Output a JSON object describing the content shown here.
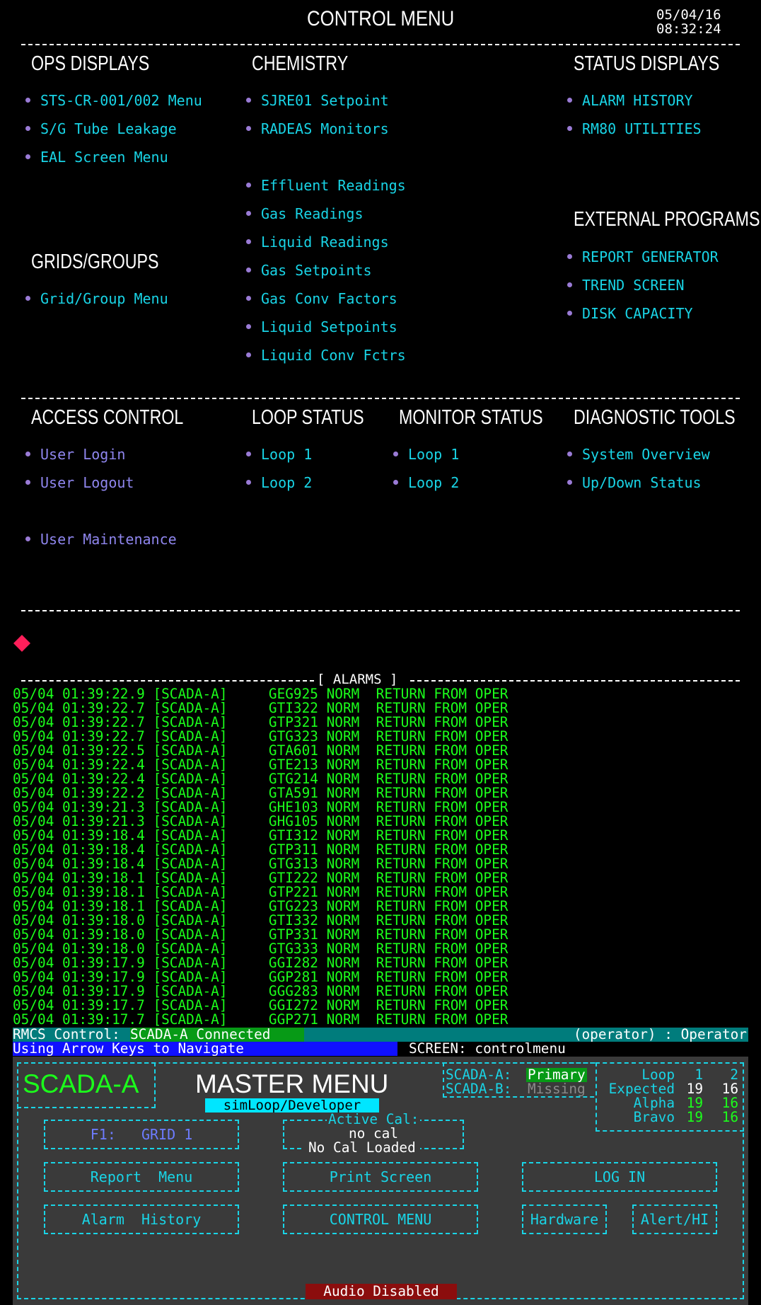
{
  "header": {
    "title": "CONTROL MENU",
    "date": "05/04/16",
    "time": "08:32:24"
  },
  "ops": {
    "title": "OPS DISPLAYS",
    "items": [
      "STS-CR-001/002 Menu",
      "S/G Tube Leakage",
      "EAL Screen Menu"
    ]
  },
  "grids": {
    "title": "GRIDS/GROUPS",
    "items": [
      "Grid/Group Menu"
    ]
  },
  "chem": {
    "title": "CHEMISTRY",
    "items": [
      "SJRE01 Setpoint",
      "RADEAS Monitors",
      "Effluent Readings",
      "Gas Readings",
      "Liquid Readings",
      "Gas Setpoints",
      "Gas Conv Factors",
      "Liquid Setpoints",
      "Liquid Conv Fctrs"
    ]
  },
  "status": {
    "title": "STATUS DISPLAYS",
    "items": [
      "ALARM HISTORY",
      "RM80 UTILITIES"
    ]
  },
  "ext": {
    "title": "EXTERNAL PROGRAMS",
    "items": [
      "REPORT GENERATOR",
      "TREND SCREEN",
      "DISK CAPACITY"
    ]
  },
  "access": {
    "title": "ACCESS CONTROL",
    "items": [
      "User Login",
      "User Logout",
      "User Maintenance"
    ]
  },
  "loop": {
    "title": "LOOP STATUS",
    "items": [
      "Loop 1",
      "Loop 2"
    ]
  },
  "monitor": {
    "title": "MONITOR STATUS",
    "items": [
      "Loop 1",
      "Loop 2"
    ]
  },
  "diag": {
    "title": "DIAGNOSTIC TOOLS",
    "items": [
      "System Overview",
      "Up/Down Status"
    ]
  },
  "alarms": {
    "title": "[ ALARMS ]",
    "rows": [
      "05/04 01:39:22.9 [SCADA-A]     GEG925 NORM  RETURN FROM OPER",
      "05/04 01:39:22.7 [SCADA-A]     GTI322 NORM  RETURN FROM OPER",
      "05/04 01:39:22.7 [SCADA-A]     GTP321 NORM  RETURN FROM OPER",
      "05/04 01:39:22.7 [SCADA-A]     GTG323 NORM  RETURN FROM OPER",
      "05/04 01:39:22.5 [SCADA-A]     GTA601 NORM  RETURN FROM OPER",
      "05/04 01:39:22.4 [SCADA-A]     GTE213 NORM  RETURN FROM OPER",
      "05/04 01:39:22.4 [SCADA-A]     GTG214 NORM  RETURN FROM OPER",
      "05/04 01:39:22.2 [SCADA-A]     GTA591 NORM  RETURN FROM OPER",
      "05/04 01:39:21.3 [SCADA-A]     GHE103 NORM  RETURN FROM OPER",
      "05/04 01:39:21.3 [SCADA-A]     GHG105 NORM  RETURN FROM OPER",
      "05/04 01:39:18.4 [SCADA-A]     GTI312 NORM  RETURN FROM OPER",
      "05/04 01:39:18.4 [SCADA-A]     GTP311 NORM  RETURN FROM OPER",
      "05/04 01:39:18.4 [SCADA-A]     GTG313 NORM  RETURN FROM OPER",
      "05/04 01:39:18.1 [SCADA-A]     GTI222 NORM  RETURN FROM OPER",
      "05/04 01:39:18.1 [SCADA-A]     GTP221 NORM  RETURN FROM OPER",
      "05/04 01:39:18.1 [SCADA-A]     GTG223 NORM  RETURN FROM OPER",
      "05/04 01:39:18.0 [SCADA-A]     GTI332 NORM  RETURN FROM OPER",
      "05/04 01:39:18.0 [SCADA-A]     GTP331 NORM  RETURN FROM OPER",
      "05/04 01:39:18.0 [SCADA-A]     GTG333 NORM  RETURN FROM OPER",
      "05/04 01:39:17.9 [SCADA-A]     GGI282 NORM  RETURN FROM OPER",
      "05/04 01:39:17.9 [SCADA-A]     GGP281 NORM  RETURN FROM OPER",
      "05/04 01:39:17.9 [SCADA-A]     GGG283 NORM  RETURN FROM OPER",
      "05/04 01:39:17.7 [SCADA-A]     GGI272 NORM  RETURN FROM OPER",
      "05/04 01:39:17.7 [SCADA-A]     GGP271 NORM  RETURN FROM OPER"
    ]
  },
  "statusbar": {
    "rmcs_label": "RMCS Control:",
    "rmcs_value": "SCADA-A Connected",
    "operator": "(operator) : Operator",
    "nav_hint": "Using Arrow Keys to Navigate",
    "screen": "SCREEN: controlmenu"
  },
  "panel": {
    "scada": "SCADA-A",
    "title": "MASTER MENU",
    "subtitle": "simLoop/Developer",
    "scada_a_label": "SCADA-A:",
    "scada_a_value": "Primary",
    "scada_b_label": "SCADA-B:",
    "scada_b_value": "Missing",
    "loop_table": {
      "header": [
        "Loop",
        "1",
        "2"
      ],
      "rows": [
        {
          "label": "Expected",
          "v1": "19",
          "v2": "16"
        },
        {
          "label": "Alpha",
          "v1": "19",
          "v2": "16"
        },
        {
          "label": "Bravo",
          "v1": "19",
          "v2": "16"
        }
      ]
    },
    "active_cal_label": "Active Cal:",
    "active_cal_value": "no cal",
    "active_cal_status": "No Cal Loaded",
    "buttons": {
      "f1": "F1:   GRID 1",
      "report": "Report  Menu",
      "print": "Print Screen",
      "login": "LOG IN",
      "alarm": "Alarm  History",
      "control": "CONTROL MENU",
      "hardware": "Hardware",
      "alert": "Alert/HI"
    },
    "audio": "Audio Disabled"
  },
  "colors": {
    "accent": "#19d4e6",
    "alarm_green": "#1bff1b",
    "bullet": "#9a7bd6",
    "panel_bg": "#3a3a3a",
    "audio_bg": "#8b0d0d",
    "marker": "#ff1f5a"
  }
}
